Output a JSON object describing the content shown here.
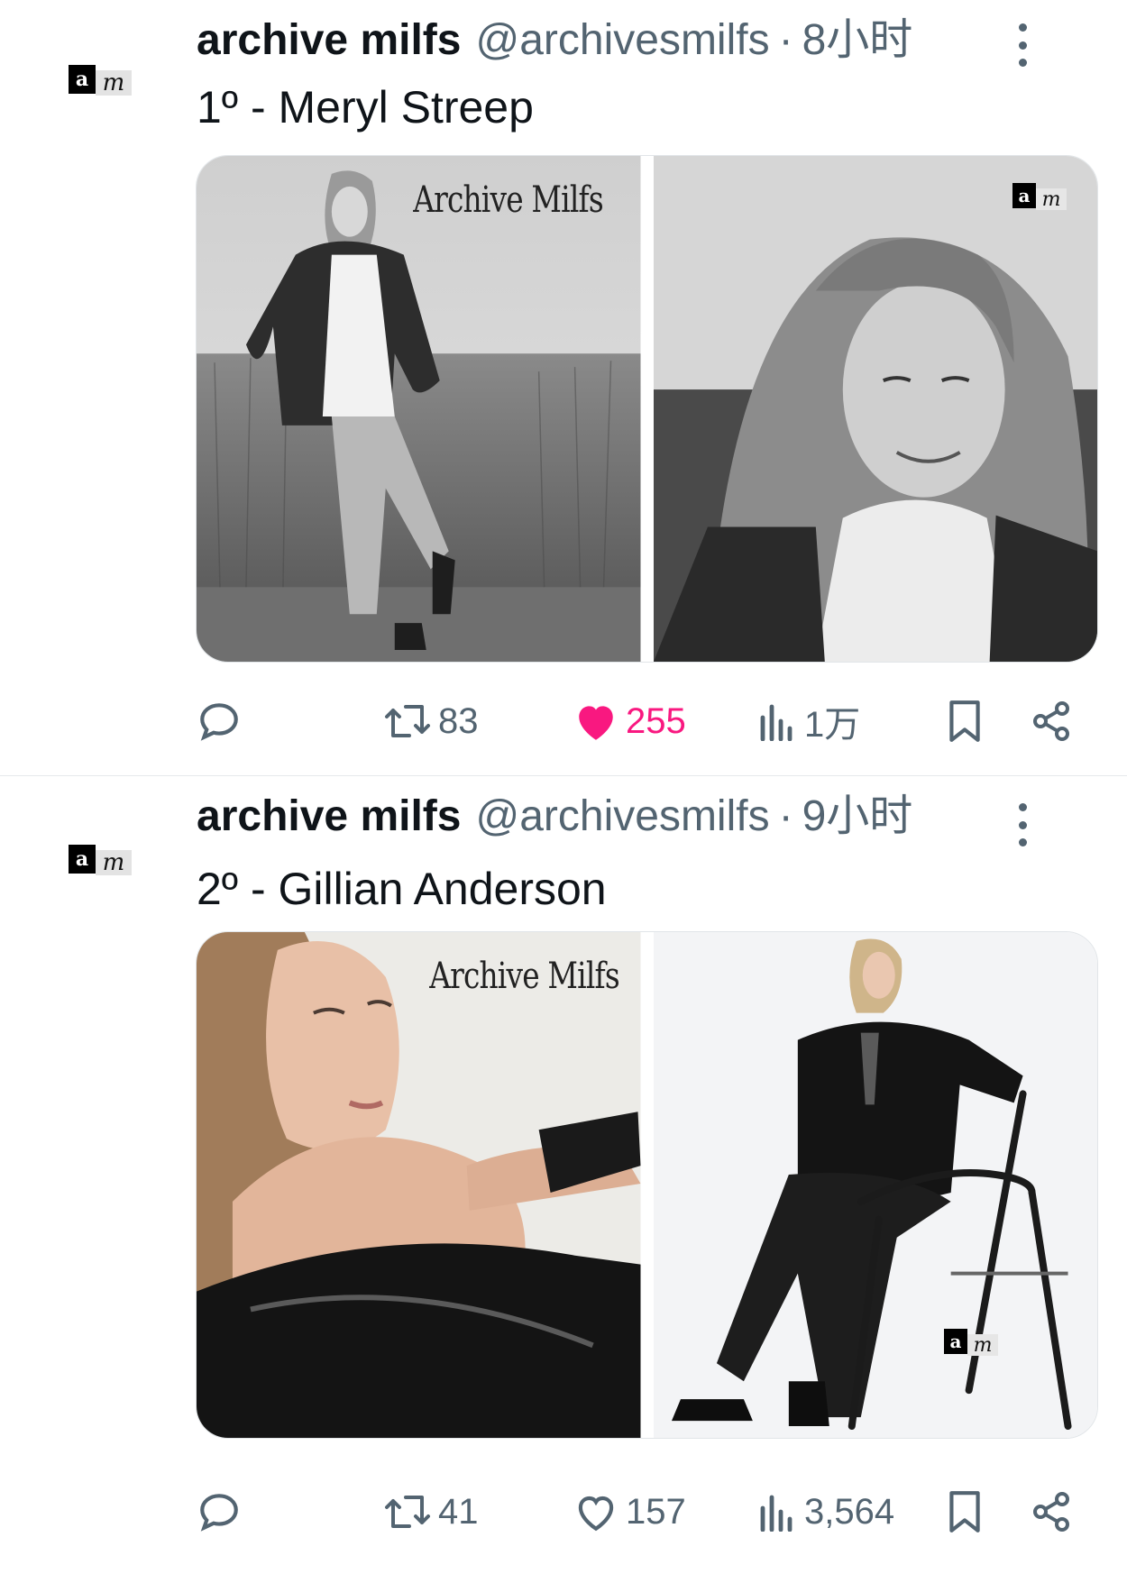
{
  "tweets": [
    {
      "author_name": "archive milfs",
      "handle": "@archivesmilfs",
      "separator": "·",
      "time": "8小时",
      "text": "1º - Meryl Streep",
      "watermark_text": "Archive Milfs",
      "avatar_letters": {
        "a": "a",
        "m": "m"
      },
      "stats": {
        "retweets": "83",
        "likes": "255",
        "views": "1万"
      },
      "liked": true
    },
    {
      "author_name": "archive milfs",
      "handle": "@archivesmilfs",
      "separator": "·",
      "time": "9小时",
      "text": "2º - Gillian Anderson",
      "watermark_text": "Archive Milfs",
      "avatar_letters": {
        "a": "a",
        "m": "m"
      },
      "stats": {
        "retweets": "41",
        "likes": "157",
        "views": "3,564"
      },
      "liked": false
    }
  ],
  "icons": {
    "reply": "reply-icon",
    "retweet": "retweet-icon",
    "like": "heart-icon",
    "views": "views-icon",
    "bookmark": "bookmark-icon",
    "share": "share-icon",
    "more": "more-icon"
  },
  "colors": {
    "like_active": "#f91880",
    "secondary_text": "#536471",
    "primary_text": "#0f1419"
  }
}
